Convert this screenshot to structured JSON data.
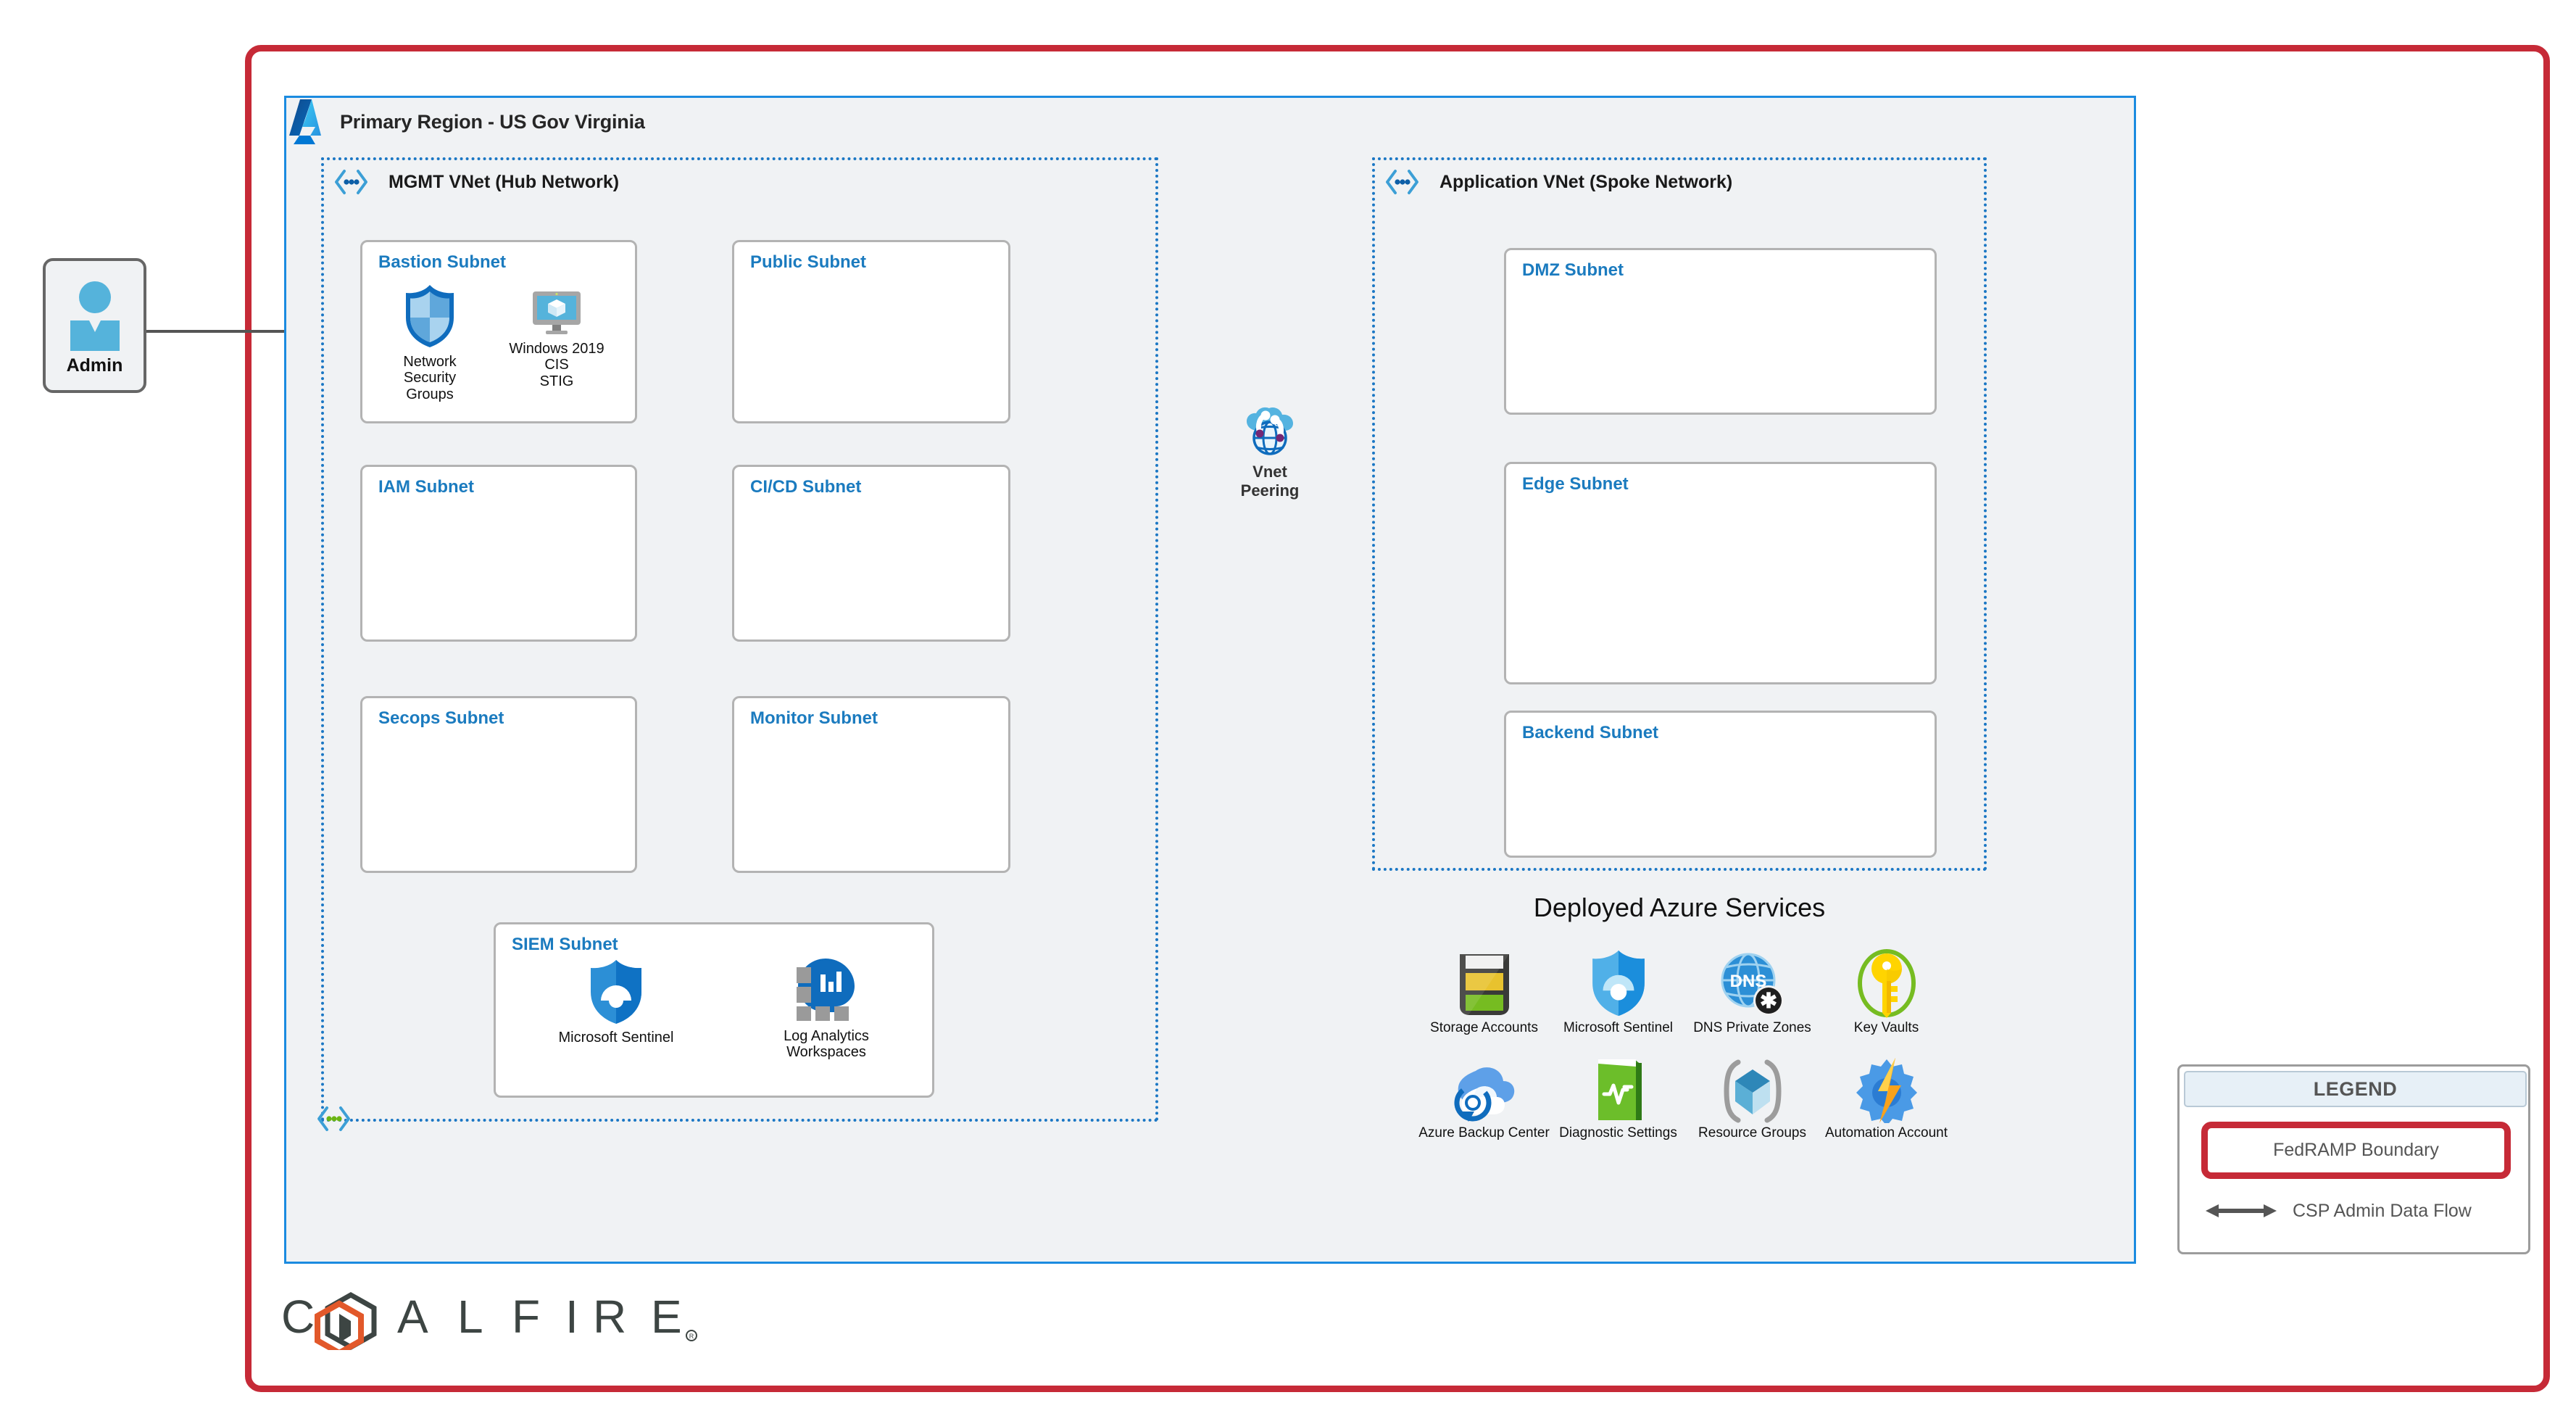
{
  "region": {
    "title": "Primary Region - US Gov Virginia",
    "logo_icon": "azure-logo-icon"
  },
  "admin": {
    "label": "Admin",
    "icon": "user-admin-icon"
  },
  "hub_vnet": {
    "label": "MGMT VNet (Hub Network)",
    "icon": "vnet-icon",
    "corner_icon": "vnet-icon-green",
    "subnets": [
      {
        "title": "Bastion Subnet"
      },
      {
        "title": "Public Subnet"
      },
      {
        "title": "IAM Subnet"
      },
      {
        "title": "CI/CD Subnet"
      },
      {
        "title": "Secops Subnet"
      },
      {
        "title": "Monitor Subnet"
      },
      {
        "title": "SIEM Subnet"
      }
    ],
    "bastion_nodes": [
      {
        "label": "Network Security\nGroups",
        "icon": "shield-nsg-icon"
      },
      {
        "label": "Windows 2019 CIS\nSTIG",
        "icon": "windows-vm-monitor-icon"
      }
    ],
    "siem_nodes": [
      {
        "label": "Microsoft Sentinel",
        "icon": "microsoft-sentinel-icon"
      },
      {
        "label": "Log Analytics\nWorkspaces",
        "icon": "log-analytics-icon"
      }
    ]
  },
  "peering": {
    "label": "Vnet\nPeering",
    "icon": "vnet-peering-icon"
  },
  "spoke_vnet": {
    "label": "Application VNet (Spoke Network)",
    "icon": "vnet-icon",
    "subnets": [
      {
        "title": "DMZ Subnet"
      },
      {
        "title": "Edge Subnet"
      },
      {
        "title": "Backend Subnet"
      }
    ]
  },
  "services": {
    "title": "Deployed Azure Services",
    "rows": [
      [
        {
          "label": "Storage Accounts",
          "icon": "storage-accounts-icon"
        },
        {
          "label": "Microsoft Sentinel",
          "icon": "microsoft-sentinel-icon"
        },
        {
          "label": "DNS Private Zones",
          "icon": "dns-private-zones-icon"
        },
        {
          "label": "Key Vaults",
          "icon": "key-vault-icon"
        }
      ],
      [
        {
          "label": "Azure Backup Center",
          "icon": "azure-backup-center-icon"
        },
        {
          "label": "Diagnostic Settings",
          "icon": "diagnostic-settings-icon"
        },
        {
          "label": "Resource Groups",
          "icon": "resource-groups-icon"
        },
        {
          "label": "Automation Account",
          "icon": "automation-account-icon"
        }
      ]
    ]
  },
  "legend": {
    "title": "LEGEND",
    "boundary_label": "FedRAMP Boundary",
    "flow_label": "CSP Admin Data Flow",
    "flow_icon": "double-arrow-icon"
  },
  "branding": {
    "logo_text": "COALFIRE",
    "logo_icon": "coalfire-logo"
  },
  "colors": {
    "fedramp_red": "#C62A37",
    "azure_blue": "#1B8BE0",
    "vnet_dash_blue": "#1B77C4",
    "subnet_title_blue": "#1B7BBF",
    "panel_bg": "#F0F2F4",
    "connector_gray": "#555555"
  }
}
